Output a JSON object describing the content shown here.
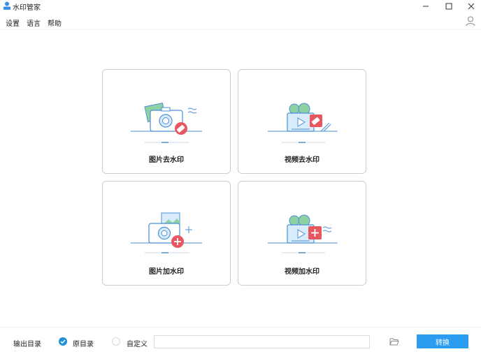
{
  "window": {
    "title": "水印管家",
    "controls": [
      "minimize-icon",
      "maximize-icon",
      "close-icon"
    ]
  },
  "menu": {
    "settings": "设置",
    "language": "语言",
    "help": "帮助",
    "user_icon": "user-icon"
  },
  "cards": [
    {
      "label": "图片去水印",
      "icon": "image-remove-watermark-icon"
    },
    {
      "label": "视频去水印",
      "icon": "video-remove-watermark-icon"
    },
    {
      "label": "图片加水印",
      "icon": "image-add-watermark-icon"
    },
    {
      "label": "视频加水印",
      "icon": "video-add-watermark-icon"
    }
  ],
  "output": {
    "label": "输出目录",
    "option_original": "原目录",
    "option_custom": "自定义",
    "selected": "原目录",
    "path_value": "",
    "convert_label": "转换"
  },
  "colors": {
    "accent": "#2c9cf0",
    "icon_blue": "#4a8fd6",
    "icon_red": "#e8575f",
    "icon_green": "#8ed1a3"
  }
}
